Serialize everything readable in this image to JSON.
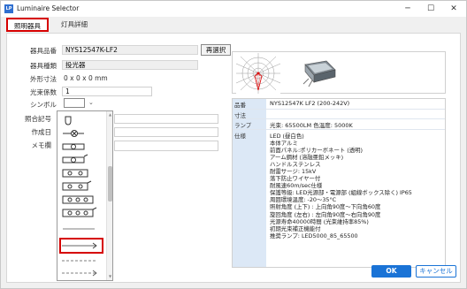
{
  "window": {
    "icon_text": "LP",
    "title": "Luminaire Selector",
    "minimize": "─",
    "maximize": "☐",
    "close": "✕"
  },
  "tabs": [
    {
      "label": "照明器具"
    },
    {
      "label": "灯具詳細"
    }
  ],
  "form": {
    "product_code_label": "器具品番",
    "product_code_value": "NYS12547K-LF2",
    "reselect_button": "再選択",
    "type_label": "器具種類",
    "type_value": "投光器",
    "dimensions_label": "外形寸法",
    "dimensions_value": "0 x 0 x 0 mm",
    "coefficient_label": "光束係数",
    "coefficient_value": "1",
    "symbol_label": "シンボル",
    "illum_symbol_label": "照合記号",
    "created_label": "作成日",
    "memo_label": "メモ欄"
  },
  "spec": {
    "rows": [
      {
        "key": "品番",
        "value": "NYS12547K LF2 (200-242V)"
      },
      {
        "key": "寸法",
        "value": ""
      },
      {
        "key": "ランプ",
        "value": "光束: 65500LM 色温度: 5000K"
      }
    ],
    "details_key": "仕様",
    "details": [
      "LED (昼白色)",
      "本体アルミ",
      "前面パネル:ポリカーボネート (透明)",
      "アーム鋼材 (溶融亜鉛メッキ)",
      "ハンドルステンレス",
      "耐雷サージ: 15kV",
      "落下防止ワイヤー付",
      "耐風速60m/sec仕様",
      "保護等級: LED光源部・電源部 (組線ボックス除く) IP65",
      "周囲環境温度: -20〜35°C",
      "照射角度 (上下) : 上向角90度〜下向角60度",
      "旋回角度 (左右) : 左向角90度〜右向角90度",
      "光源寿命40000時間 (光束維持率85%)",
      "初期光束補正機能付",
      "推奨ランプ: LED5000_85_65500"
    ]
  },
  "buttons": {
    "ok": "OK",
    "cancel": "キャンセル"
  },
  "colors": {
    "accent_red": "#d60000",
    "primary_blue": "#1a73d6",
    "spec_header_bg": "#dce8f6"
  }
}
